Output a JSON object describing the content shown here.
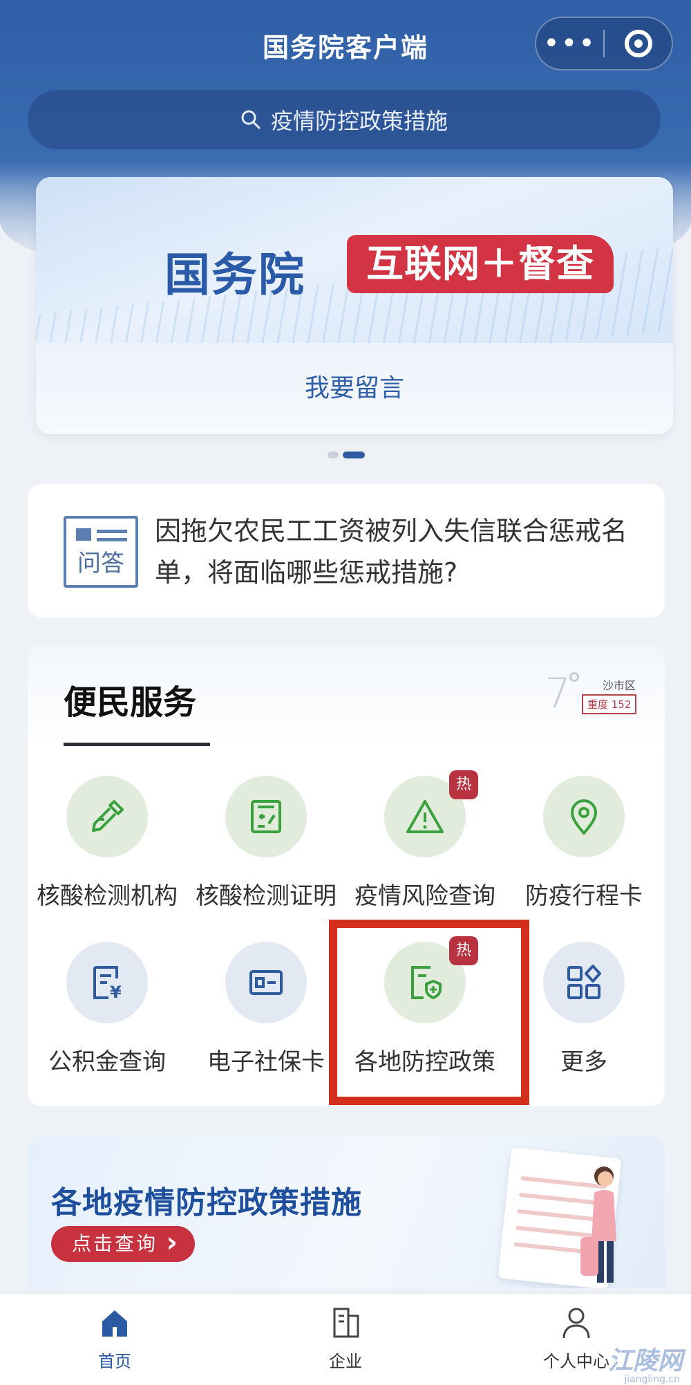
{
  "header": {
    "title": "国务院客户端",
    "capsule_more": "•••",
    "search_placeholder": "疫情防控政策措施"
  },
  "banner": {
    "brand": "国务院",
    "tag": "互联网＋督查",
    "cta": "我要留言",
    "carousel": {
      "count": 2,
      "active_index": 1
    }
  },
  "qa_card": {
    "icon_label": "问答",
    "text": "因拖欠农民工工资被列入失信联合惩戒名单，将面临哪些惩戒措施?"
  },
  "services": {
    "title": "便民服务",
    "weather": {
      "temperature": "7",
      "city": "沙市区",
      "aqi": "重度 152"
    },
    "hot_badge": "热",
    "items": [
      {
        "label": "核酸检测机构",
        "icon": "dropper-icon",
        "hot": false
      },
      {
        "label": "核酸检测证明",
        "icon": "test-certificate-icon",
        "hot": false
      },
      {
        "label": "疫情风险查询",
        "icon": "warning-triangle-icon",
        "hot": true
      },
      {
        "label": "防疫行程卡",
        "icon": "location-pin-icon",
        "hot": false
      },
      {
        "label": "公积金查询",
        "icon": "fund-document-icon",
        "hot": false
      },
      {
        "label": "电子社保卡",
        "icon": "id-card-icon",
        "hot": false
      },
      {
        "label": "各地防控政策",
        "icon": "policy-shield-icon",
        "hot": true
      },
      {
        "label": "更多",
        "icon": "grid-more-icon",
        "hot": false
      }
    ]
  },
  "promo": {
    "title": "各地疫情防控政策措施",
    "button": "点击查询"
  },
  "tabbar": {
    "tabs": [
      {
        "label": "首页",
        "icon": "home-icon",
        "active": true
      },
      {
        "label": "企业",
        "icon": "building-icon",
        "active": false
      },
      {
        "label": "个人中心",
        "icon": "person-icon",
        "active": false
      }
    ]
  },
  "watermark": {
    "text": "江陵网",
    "url": "jiangling.cn"
  },
  "colors": {
    "brand_blue": "#2f5fa6",
    "accent_red": "#d23443",
    "highlight_red": "#d32f1f",
    "icon_green": "#3aa13c",
    "icon_blue": "#2f5aa0"
  }
}
